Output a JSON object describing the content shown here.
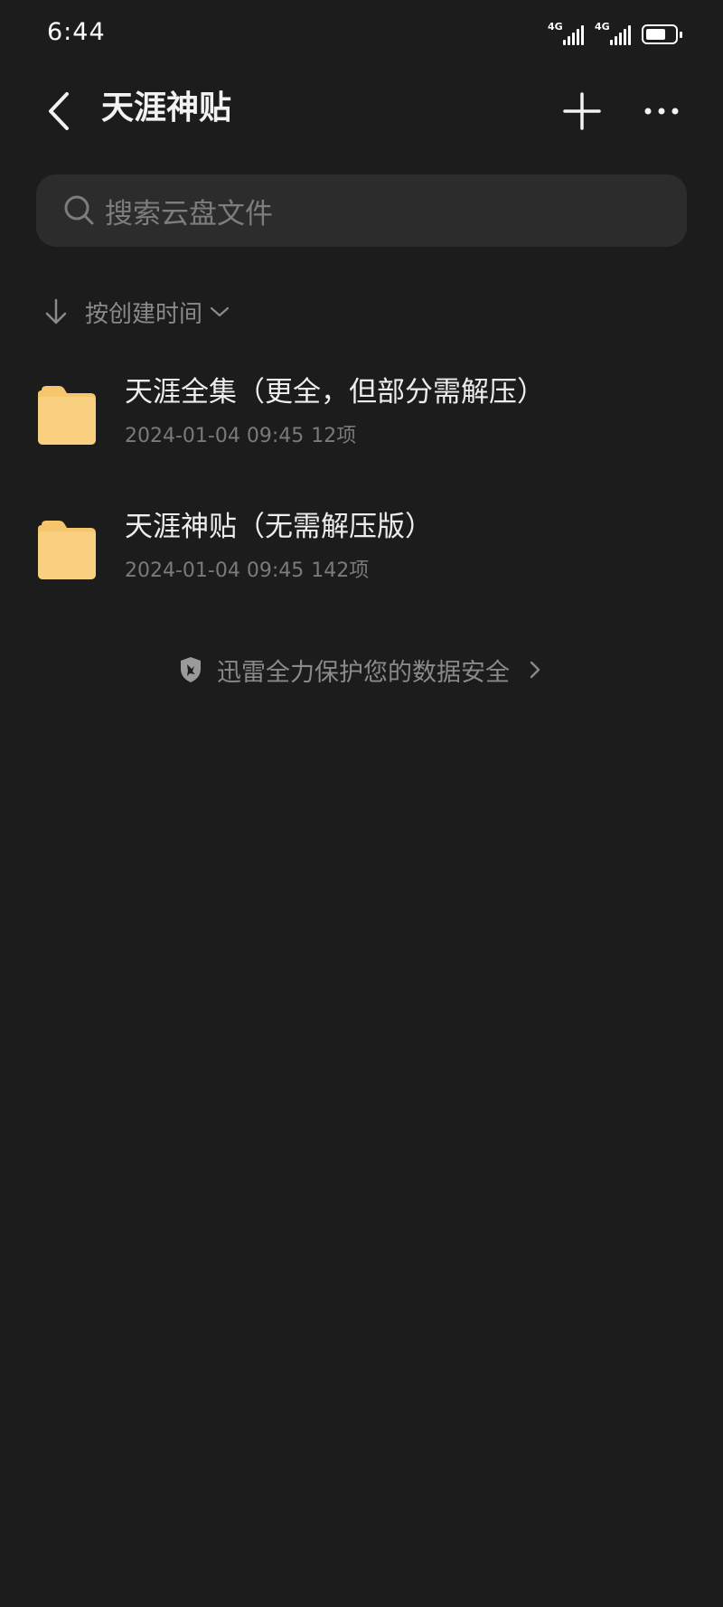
{
  "status_bar": {
    "time": "6:44",
    "network_1": "4G",
    "network_2": "4G",
    "battery_level": 0.7
  },
  "header": {
    "title": "天涯神贴",
    "back_icon": "chevron-left-icon",
    "add_icon": "plus-icon",
    "more_icon": "more-horizontal-icon"
  },
  "search": {
    "placeholder": "搜索云盘文件",
    "icon": "search-icon"
  },
  "sort": {
    "label": "按创建时间",
    "direction_icon": "arrow-down-icon",
    "dropdown_icon": "chevron-down-icon"
  },
  "files": [
    {
      "name": "天涯全集（更全，但部分需解压）",
      "datetime": "2024-01-04 09:45",
      "count": "12项",
      "icon": "folder-icon"
    },
    {
      "name": "天涯神贴（无需解压版）",
      "datetime": "2024-01-04 09:45",
      "count": "142项",
      "icon": "folder-icon"
    }
  ],
  "security_banner": {
    "text": "迅雷全力保护您的数据安全",
    "icon": "shield-icon"
  },
  "colors": {
    "background": "#1c1c1c",
    "search_bg": "#2c2c2c",
    "folder": "#f6c66e",
    "primary_text": "#ededed",
    "secondary_text": "#7a7a7a"
  }
}
